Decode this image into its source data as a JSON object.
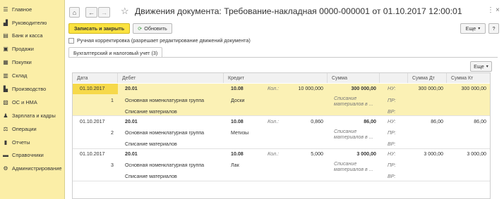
{
  "sidebar": {
    "items": [
      {
        "label": "Главное",
        "icon": "home-lines-icon"
      },
      {
        "label": "Руководителю",
        "icon": "chart-icon"
      },
      {
        "label": "Банк и касса",
        "icon": "bank-icon"
      },
      {
        "label": "Продажи",
        "icon": "cart-icon"
      },
      {
        "label": "Покупки",
        "icon": "basket-icon"
      },
      {
        "label": "Склад",
        "icon": "warehouse-icon"
      },
      {
        "label": "Производство",
        "icon": "factory-icon"
      },
      {
        "label": "ОС и НМА",
        "icon": "assets-icon"
      },
      {
        "label": "Зарплата и кадры",
        "icon": "people-icon"
      },
      {
        "label": "Операции",
        "icon": "operations-icon"
      },
      {
        "label": "Отчеты",
        "icon": "reports-icon"
      },
      {
        "label": "Справочники",
        "icon": "book-icon"
      },
      {
        "label": "Администрирование",
        "icon": "gear-icon"
      }
    ]
  },
  "header": {
    "title": "Движения документа: Требование-накладная 0000-000001 от 01.10.2017 12:00:01",
    "home": "⌂",
    "back": "←",
    "forward": "→",
    "star": "☆",
    "more_dots": "⋮",
    "close": "×"
  },
  "toolbar": {
    "save_close_label": "Записать и закрыть",
    "refresh_label": "Обновить",
    "more_label": "Еще",
    "help_label": "?",
    "manual_edit_label": "Ручная корректировка (разрешает редактирование движений документа)"
  },
  "tab": {
    "label": "Бухгалтерский и налоговый учет (3)"
  },
  "table": {
    "more_label": "Еще",
    "columns": [
      "Дата",
      "Дебет",
      "Кредит",
      "Сумма",
      "Сумма Дт",
      "Сумма Кт"
    ],
    "rows": [
      {
        "date": "01.10.2017",
        "num": "1",
        "debit": "20.01",
        "debit_sub1": "Основная номенклатурная группа",
        "debit_sub2": "Списание материалов",
        "credit": "10.08",
        "credit_sub1": "Доски",
        "qty_label": "Кол.:",
        "qty": "10 000,000",
        "sum": "300 000,00",
        "sum_note": "Списание материалов в ...",
        "nu_label": "НУ:",
        "pr_label": "ПР:",
        "vr_label": "ВР:",
        "sum_dt": "300 000,00",
        "sum_kt": "300 000,00"
      },
      {
        "date": "01.10.2017",
        "num": "2",
        "debit": "20.01",
        "debit_sub1": "Основная номенклатурная группа",
        "debit_sub2": "Списание материалов",
        "credit": "10.08",
        "credit_sub1": "Метизы",
        "qty_label": "Кол.:",
        "qty": "0,860",
        "sum": "86,00",
        "sum_note": "Списание материалов в ...",
        "nu_label": "НУ:",
        "pr_label": "ПР:",
        "vr_label": "ВР:",
        "sum_dt": "86,00",
        "sum_kt": "86,00"
      },
      {
        "date": "01.10.2017",
        "num": "3",
        "debit": "20.01",
        "debit_sub1": "Основная номенклатурная группа",
        "debit_sub2": "Списание материалов",
        "credit": "10.08",
        "credit_sub1": "Лак",
        "qty_label": "Кол.:",
        "qty": "5,000",
        "sum": "3 000,00",
        "sum_note": "Списание материалов в ...",
        "nu_label": "НУ:",
        "pr_label": "ПР:",
        "vr_label": "ВР:",
        "sum_dt": "3 000,00",
        "sum_kt": "3 000,00"
      }
    ]
  }
}
